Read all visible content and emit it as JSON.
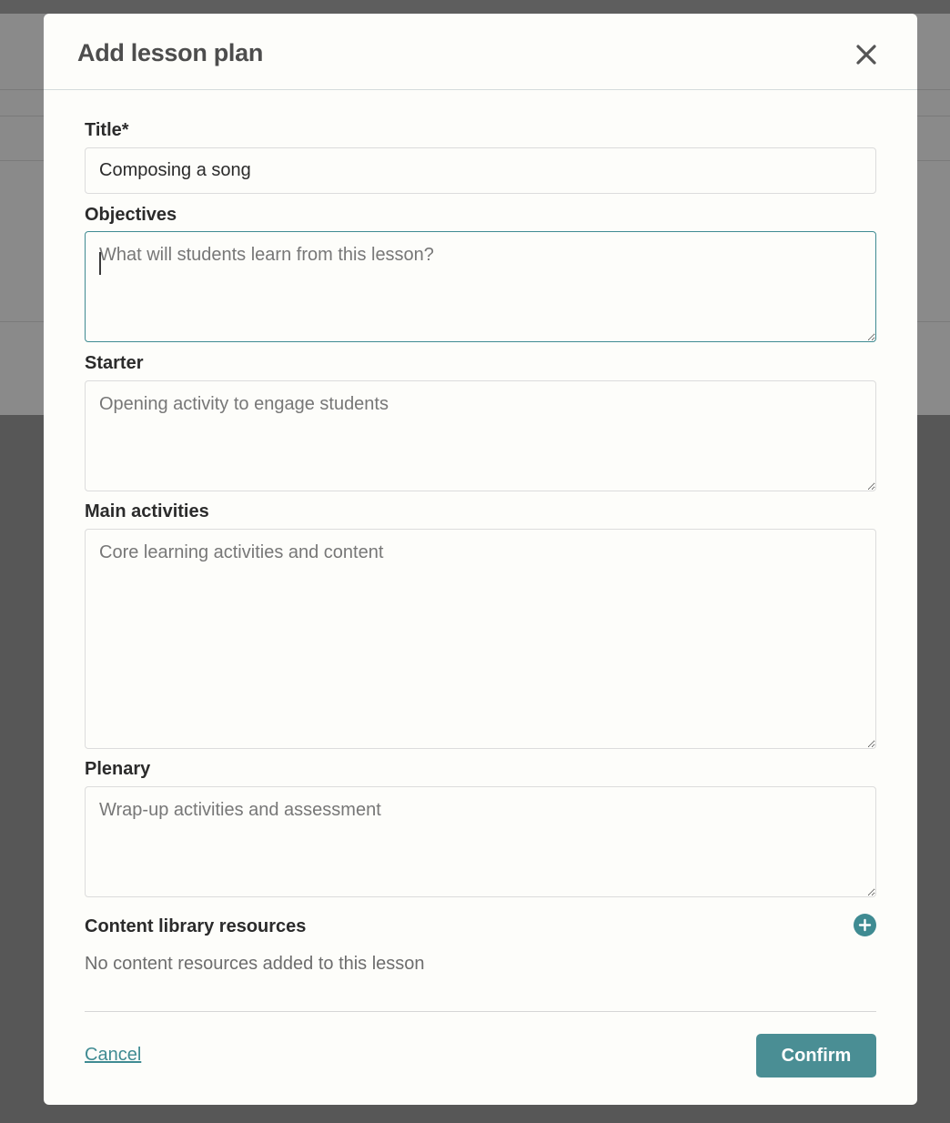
{
  "dialog": {
    "title": "Add lesson plan",
    "close_icon": "close-icon"
  },
  "form": {
    "title": {
      "label": "Title*",
      "value": "Composing a song"
    },
    "objectives": {
      "label": "Objectives",
      "placeholder": "What will students learn from this lesson?",
      "value": ""
    },
    "starter": {
      "label": "Starter",
      "placeholder": "Opening activity to engage students",
      "value": ""
    },
    "main_activities": {
      "label": "Main activities",
      "placeholder": "Core learning activities and content",
      "value": ""
    },
    "plenary": {
      "label": "Plenary",
      "placeholder": "Wrap-up activities and assessment",
      "value": ""
    }
  },
  "resources": {
    "label": "Content library resources",
    "add_icon": "plus-circle-icon",
    "empty_text": "No content resources added to this lesson"
  },
  "footer": {
    "cancel_label": "Cancel",
    "confirm_label": "Confirm"
  },
  "colors": {
    "accent": "#3f8b92",
    "modal_background": "#fdfdfa",
    "overlay": "#575757"
  }
}
